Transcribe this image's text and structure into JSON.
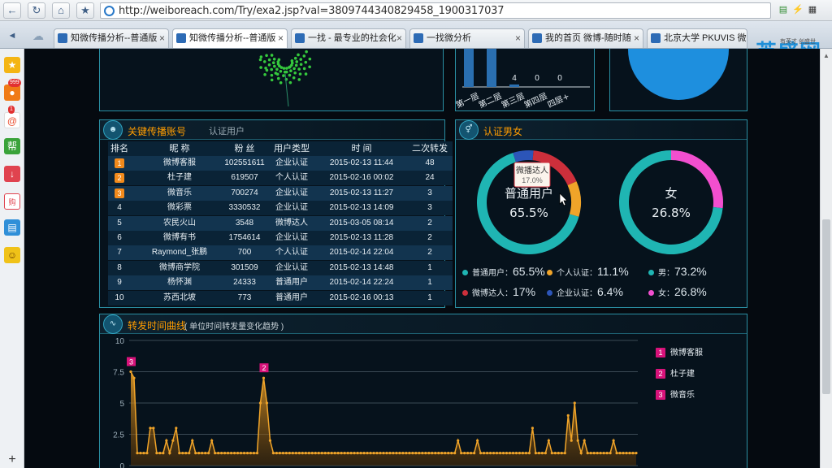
{
  "browser": {
    "url": "http://weiboreach.com/Try/exa2.jsp?val=3809744340829458_1900317037",
    "tabs": [
      {
        "label": "知微传播分析--普通版",
        "active": false
      },
      {
        "label": "知微传播分析--普通版",
        "active": true
      },
      {
        "label": "一找 - 最专业的社会化",
        "active": false
      },
      {
        "label": "一找微分析",
        "active": false
      },
      {
        "label": "我的首页 微博-随时随",
        "active": false
      },
      {
        "label": "北京大学 PKUVIS 微博",
        "active": false
      }
    ],
    "brand": "英盛网",
    "brand_sub": "有英才 创盛世",
    "sidebar_badges": {
      "weibo": "999",
      "mail": "1"
    },
    "sidebar_items": [
      "favorites",
      "weibo",
      "mail",
      "help",
      "download",
      "shop",
      "reader",
      "emoji"
    ]
  },
  "bar_fragment": {
    "labels": [
      "第一层",
      "第二层",
      "第三层",
      "第四层",
      "四层+"
    ],
    "values_shown": [
      "",
      "",
      "4",
      "0",
      "0"
    ]
  },
  "key_accounts": {
    "title": "关键传播账号",
    "tab2": "认证用户",
    "columns": [
      "排名",
      "昵 称",
      "粉 丝",
      "用户类型",
      "时 间",
      "二次转发"
    ],
    "rows": [
      {
        "rank": "1",
        "name": "微博客服",
        "fans": "102551611",
        "type": "企业认证",
        "time": "2015-02-13 11:44",
        "reposts": "48",
        "highlight": true
      },
      {
        "rank": "2",
        "name": "杜子建",
        "fans": "619507",
        "type": "个人认证",
        "time": "2015-02-16 00:02",
        "reposts": "24",
        "highlight": true
      },
      {
        "rank": "3",
        "name": "微音乐",
        "fans": "700274",
        "type": "企业认证",
        "time": "2015-02-13 11:27",
        "reposts": "3",
        "highlight": true
      },
      {
        "rank": "4",
        "name": "微彩票",
        "fans": "3330532",
        "type": "企业认证",
        "time": "2015-02-13 14:09",
        "reposts": "3",
        "highlight": false
      },
      {
        "rank": "5",
        "name": "农民火山",
        "fans": "3548",
        "type": "微博达人",
        "time": "2015-03-05 08:14",
        "reposts": "2",
        "highlight": false
      },
      {
        "rank": "6",
        "name": "微博有书",
        "fans": "1754614",
        "type": "企业认证",
        "time": "2015-02-13 11:28",
        "reposts": "2",
        "highlight": false
      },
      {
        "rank": "7",
        "name": "Raymond_张鹏",
        "fans": "700",
        "type": "个人认证",
        "time": "2015-02-14 22:04",
        "reposts": "2",
        "highlight": false
      },
      {
        "rank": "8",
        "name": "微博商学院",
        "fans": "301509",
        "type": "企业认证",
        "time": "2015-02-13 14:48",
        "reposts": "1",
        "highlight": false
      },
      {
        "rank": "9",
        "name": "杨怀渊",
        "fans": "24333",
        "type": "普通用户",
        "time": "2015-02-14 22:24",
        "reposts": "1",
        "highlight": false
      },
      {
        "rank": "10",
        "name": "苏西北坡",
        "fans": "773",
        "type": "普通用户",
        "time": "2015-02-16 00:13",
        "reposts": "1",
        "highlight": false
      }
    ]
  },
  "auth_gender": {
    "title": "认证男女",
    "donut1": {
      "center_label": "普通用户",
      "center_value": "65.5%",
      "segments": [
        {
          "name": "普通用户",
          "value": 65.5,
          "color": "#1fb5b3"
        },
        {
          "name": "个人认证",
          "value": 11.1,
          "color": "#f0a429"
        },
        {
          "name": "微博达人",
          "value": 17.0,
          "color": "#cc2f3b"
        },
        {
          "name": "企业认证",
          "value": 6.4,
          "color": "#2c55b8"
        }
      ],
      "tooltip_name": "微播达人",
      "tooltip_value": "17.0%"
    },
    "donut2": {
      "center_label": "女",
      "center_value": "26.8%",
      "segments": [
        {
          "name": "男",
          "value": 73.2,
          "color": "#1fb5b3"
        },
        {
          "name": "女",
          "value": 26.8,
          "color": "#f24fcf"
        }
      ]
    },
    "legend": [
      {
        "label": "普通用户：",
        "value": "65.5%",
        "color": "#1fb5b3"
      },
      {
        "label": "个人认证：",
        "value": "11.1%",
        "color": "#f0a429"
      },
      {
        "label": "男：",
        "value": "73.2%",
        "color": "#1fb5b3"
      },
      {
        "label": "微博达人：",
        "value": "17%",
        "color": "#cc2f3b"
      },
      {
        "label": "企业认证：",
        "value": "6.4%",
        "color": "#2c55b8"
      },
      {
        "label": "女：",
        "value": "26.8%",
        "color": "#f24fcf"
      }
    ]
  },
  "repost_curve": {
    "title": "转发时间曲线",
    "subtitle": "( 单位时间转发量变化趋势 )",
    "legend": [
      {
        "num": "1",
        "name": "微博客服"
      },
      {
        "num": "2",
        "name": "杜子建"
      },
      {
        "num": "3",
        "name": "微音乐"
      }
    ],
    "markers": [
      {
        "num": "3",
        "index": 0
      },
      {
        "num": "2",
        "index": 41
      }
    ]
  },
  "chart_data": {
    "type": "area",
    "title": "转发时间曲线",
    "ylim": [
      0,
      10
    ],
    "yticks": [
      "10",
      "7.5",
      "5",
      "2.5",
      "0"
    ],
    "color": "#f0a429",
    "values": [
      7.5,
      7,
      1,
      1,
      1,
      1,
      3,
      3,
      1,
      1,
      1,
      2,
      1,
      2,
      3,
      1,
      1,
      1,
      1,
      2,
      1,
      1,
      1,
      1,
      1,
      2,
      1,
      1,
      1,
      1,
      1,
      1,
      1,
      1,
      1,
      1,
      1,
      1,
      1,
      1,
      5,
      7,
      5,
      2,
      1,
      1,
      1,
      1,
      1,
      1,
      1,
      1,
      1,
      1,
      1,
      1,
      1,
      1,
      1,
      1,
      1,
      1,
      1,
      1,
      1,
      1,
      1,
      1,
      1,
      1,
      1,
      1,
      1,
      1,
      1,
      1,
      1,
      1,
      1,
      1,
      1,
      1,
      1,
      1,
      1,
      1,
      1,
      1,
      1,
      1,
      1,
      1,
      1,
      1,
      1,
      1,
      1,
      1,
      1,
      1,
      1,
      2,
      1,
      1,
      1,
      1,
      1,
      2,
      1,
      1,
      1,
      1,
      1,
      1,
      1,
      1,
      1,
      1,
      1,
      1,
      1,
      1,
      1,
      1,
      3,
      1,
      1,
      1,
      1,
      2,
      1,
      1,
      1,
      1,
      1,
      4,
      2,
      5,
      2,
      1,
      2,
      1,
      1,
      1,
      1,
      1,
      1,
      1,
      1,
      2,
      1,
      1,
      1,
      1,
      1,
      1,
      1
    ]
  }
}
